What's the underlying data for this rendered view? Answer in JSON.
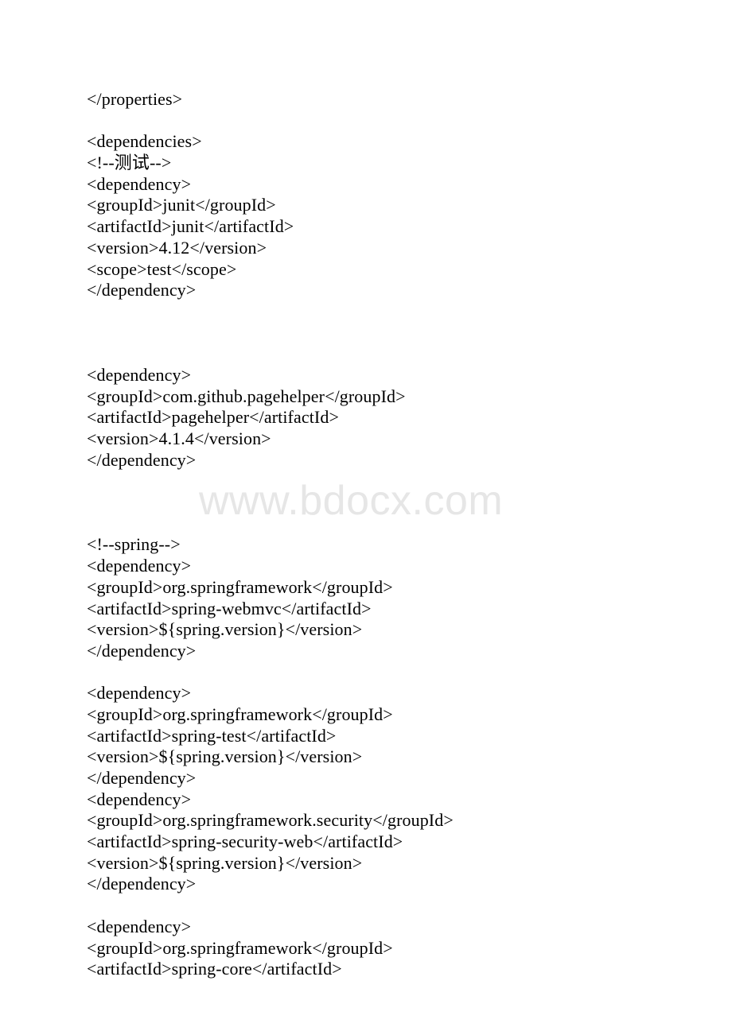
{
  "document": {
    "type": "text-document-page",
    "background_color": "#ffffff",
    "text_color": "#000000",
    "watermark": {
      "text": "www.bdocx.com",
      "color": "#e6e6e6"
    },
    "content_lines": [
      "</properties>",
      "",
      "<dependencies>",
      "<!--测试-->",
      "<dependency>",
      "<groupId>junit</groupId>",
      "<artifactId>junit</artifactId>",
      "<version>4.12</version>",
      "<scope>test</scope>",
      "</dependency>",
      "",
      "",
      "",
      "<dependency>",
      "<groupId>com.github.pagehelper</groupId>",
      "<artifactId>pagehelper</artifactId>",
      "<version>4.1.4</version>",
      "</dependency>",
      "",
      "",
      "",
      "<!--spring-->",
      "<dependency>",
      "<groupId>org.springframework</groupId>",
      "<artifactId>spring-webmvc</artifactId>",
      "<version>${spring.version}</version>",
      "</dependency>",
      "",
      "<dependency>",
      "<groupId>org.springframework</groupId>",
      "<artifactId>spring-test</artifactId>",
      "<version>${spring.version}</version>",
      "</dependency>",
      "<dependency>",
      "<groupId>org.springframework.security</groupId>",
      "<artifactId>spring-security-web</artifactId>",
      "<version>${spring.version}</version>",
      "</dependency>",
      "",
      "<dependency>",
      "<groupId>org.springframework</groupId>",
      "<artifactId>spring-core</artifactId>"
    ]
  }
}
